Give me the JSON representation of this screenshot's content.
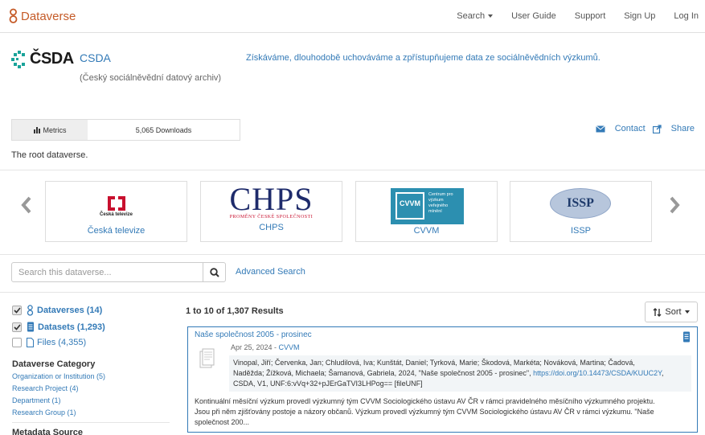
{
  "navbar": {
    "brand": "Dataverse",
    "links": [
      "Search",
      "User Guide",
      "Support",
      "Sign Up",
      "Log In"
    ]
  },
  "header": {
    "logo_text": "ČSDA",
    "name": "CSDA",
    "affiliation": "(Český sociálněvědní datový archiv)",
    "tagline": "Získáváme, dlouhodobě uchováváme a zpřístupňujeme data ze sociálněvědních výzkumů."
  },
  "metrics": {
    "label": "Metrics",
    "downloads": "5,065 Downloads"
  },
  "actions": {
    "contact": "Contact",
    "share": "Share"
  },
  "description": "The root dataverse.",
  "carousel": {
    "cards": [
      {
        "logo_text": "Česká televize",
        "caption": "Česká televize"
      },
      {
        "logo_text": "CHPS",
        "logo_subtext": "PROMĚNY ČESKÉ SPOLEČNOSTI",
        "caption": "CHPS"
      },
      {
        "logo_text": "CVVM",
        "logo_subtext": "Centrum pro výzkum veřejného mínění",
        "caption": "CVVM"
      },
      {
        "logo_text": "ISSP",
        "caption": "ISSP"
      }
    ]
  },
  "search": {
    "placeholder": "Search this dataverse...",
    "advanced": "Advanced Search"
  },
  "facets": {
    "types": [
      {
        "label": "Dataverses (14)",
        "checked": true
      },
      {
        "label": "Datasets (1,293)",
        "checked": true
      },
      {
        "label": "Files (4,355)",
        "checked": false
      }
    ],
    "category_title": "Dataverse Category",
    "category_items": [
      "Organization or Institution (5)",
      "Research Project (4)",
      "Department (1)",
      "Research Group (1)"
    ],
    "metadata_source_title": "Metadata Source"
  },
  "results": {
    "count": "1 to 10 of 1,307 Results",
    "sort_label": "Sort",
    "items": [
      {
        "title": "Naše společnost 2005 - prosinec",
        "date": "Apr 25, 2024",
        "date_sep": " - ",
        "dataverse": "CVVM",
        "citation_line1": "Vinopal, Jiří; Červenka, Jan; Chludilová, Iva; Kunštát, Daniel; Tyrková, Marie; Škodová, Markéta; Nováková, Martina; Čadová,",
        "citation_line2": "Naděžda; Žížková, Michaela; Šamanová, Gabriela, 2024, \"Naše společnost 2005 - prosinec\", ",
        "doi": "https://doi.org/10.14473/CSDA/KUUC2Y",
        "citation_sep": ",",
        "citation_line3": "CSDA, V1, UNF:6:vVq+32+pJErGaTVI3LHPog== [fileUNF]",
        "desc_line1": "Kontinuální měsíční výzkum provedl výzkumný tým CVVM Sociologického ústavu AV ČR v rámci pravidelného měsíčního výzkumného projektu.",
        "desc_line2": "Jsou při něm zjišťovány postoje a názory občanů. Výzkum provedl výzkumný tým CVVM Sociologického ústavu AV ČR v rámci výzkumu. \"Naše",
        "desc_line3": "společnost 200..."
      }
    ]
  },
  "colors": {
    "brand": "#c55b28",
    "link": "#337ab7",
    "csda_teal": "#1aa39a",
    "ct_red": "#c8102e",
    "chps_navy": "#1e2b6b",
    "cvvm_teal": "#2c8fb0"
  }
}
